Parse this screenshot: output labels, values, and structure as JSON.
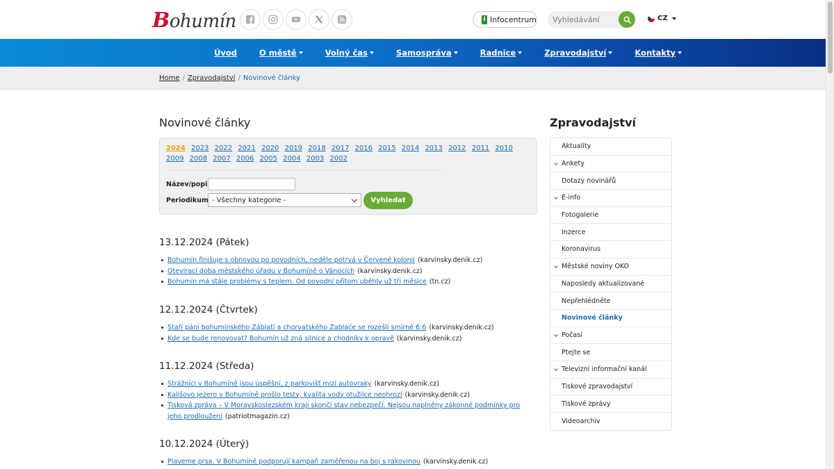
{
  "header": {
    "logo_text": "Bohumín",
    "socials": [
      "facebook-icon",
      "instagram-icon",
      "youtube-icon",
      "x-icon",
      "rss-icon"
    ],
    "infocentrum_label": "Infocentrum",
    "search_placeholder": "Vyhledávání",
    "lang": "CZ"
  },
  "nav": {
    "items": [
      {
        "label": "Úvod",
        "dropdown": false
      },
      {
        "label": "O městě",
        "dropdown": true
      },
      {
        "label": "Volný čas",
        "dropdown": true
      },
      {
        "label": "Samospráva",
        "dropdown": true
      },
      {
        "label": "Radnice",
        "dropdown": true
      },
      {
        "label": "Zpravodajství",
        "dropdown": true
      },
      {
        "label": "Kontakty",
        "dropdown": true
      }
    ]
  },
  "breadcrumb": {
    "home": "Home",
    "section": "Zpravodajství",
    "current": "Novinové články"
  },
  "main": {
    "title": "Novinové články",
    "years": [
      "2024",
      "2023",
      "2022",
      "2021",
      "2020",
      "2019",
      "2018",
      "2017",
      "2016",
      "2015",
      "2014",
      "2013",
      "2012",
      "2011",
      "2010",
      "2009",
      "2008",
      "2007",
      "2006",
      "2005",
      "2004",
      "2003",
      "2002"
    ],
    "active_year": "2024",
    "filter": {
      "name_label": "Název/popis:",
      "name_value": "",
      "periodikum_label": "Periodikum:",
      "periodikum_value": "- Všechny kategorie -",
      "search_button": "Vyhledat"
    },
    "days": [
      {
        "date": "13.12.2024 (Pátek)",
        "articles": [
          {
            "title": "Bohumín finišuje s obnovou po povodních, neděle potrvá v Červené kolonii",
            "source": "(karvinsky.denik.cz)"
          },
          {
            "title": "Otevírací doba městského úřadu v Bohumíně o Vánocích",
            "source": "(karvinsky.denik.cz)"
          },
          {
            "title": "Bohumín má stále problémy s teplem. Od povodní přitom uběhly už tři měsíce",
            "source": "(tn.cz)"
          }
        ]
      },
      {
        "date": "12.12.2024 (Čtvrtek)",
        "articles": [
          {
            "title": "Staří páni bohumínského Záblatí a chorvatského Zablaće se rozešli smírně 6:6",
            "source": "(karvinsky.denik.cz)"
          },
          {
            "title": "Kde se bude renovovat? Bohumín už zná silnice a chodníky k opravě",
            "source": "(karvinsky.denik.cz)"
          }
        ]
      },
      {
        "date": "11.12.2024 (Středa)",
        "articles": [
          {
            "title": "Strážníci v Bohumíně jsou úspěšní, z parkovišť mizí autovraky",
            "source": "(karvinsky.denik.cz)"
          },
          {
            "title": "Kališovo jezero v Bohumíně prošlo testy, kvalita vody otužilce neohrozí",
            "source": "(karvinsky.denik.cz)"
          },
          {
            "title": "Tisková zpráva – V Moravskoslezském kraji skončí stav nebezpečí. Nejsou naplněny zákonné podmínky pro jeho prodloužení",
            "source": "(patriotmagazin.cz)"
          }
        ]
      },
      {
        "date": "10.12.2024 (Úterý)",
        "articles": [
          {
            "title": "Plaveme prsa. V Bohumíně podporují kampaň zaměřenou na boj s rakovinou",
            "source": "(karvinsky.denik.cz)"
          }
        ]
      }
    ]
  },
  "sidebar": {
    "title": "Zpravodajství",
    "items": [
      {
        "label": "Aktuality",
        "expandable": false,
        "active": false
      },
      {
        "label": "Ankety",
        "expandable": true,
        "active": false
      },
      {
        "label": "Dotazy novinářů",
        "expandable": false,
        "active": false
      },
      {
        "label": "E-info",
        "expandable": true,
        "active": false
      },
      {
        "label": "Fotogalerie",
        "expandable": false,
        "active": false
      },
      {
        "label": "Inzerce",
        "expandable": false,
        "active": false
      },
      {
        "label": "Koronavirus",
        "expandable": false,
        "active": false
      },
      {
        "label": "Městské noviny OKO",
        "expandable": true,
        "active": false
      },
      {
        "label": "Naposledy aktualizované",
        "expandable": false,
        "active": false
      },
      {
        "label": "Nepřehlédněte",
        "expandable": false,
        "active": false
      },
      {
        "label": "Novinové články",
        "expandable": false,
        "active": true
      },
      {
        "label": "Počasí",
        "expandable": true,
        "active": false
      },
      {
        "label": "Ptejte se",
        "expandable": false,
        "active": false
      },
      {
        "label": "Televizní informační kanál",
        "expandable": true,
        "active": false
      },
      {
        "label": "Tiskové zpravodajství",
        "expandable": false,
        "active": false
      },
      {
        "label": "Tiskové zprávy",
        "expandable": false,
        "active": false
      },
      {
        "label": "Videoarchiv",
        "expandable": false,
        "active": false
      }
    ]
  },
  "colors": {
    "accent_green": "#6aaa37",
    "link_blue": "#1a6bb8",
    "active_year": "#f39c12",
    "brand_red": "#c8102e"
  }
}
